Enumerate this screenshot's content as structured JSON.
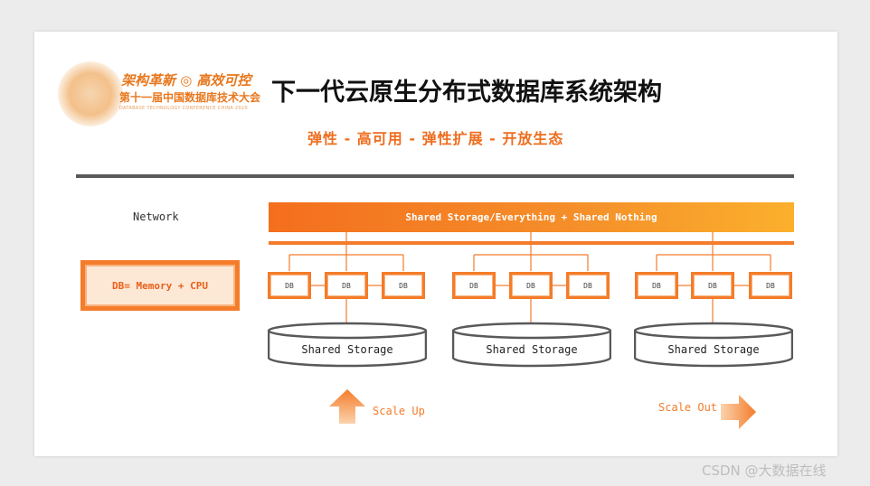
{
  "logo": {
    "line1": "架构革新 ◎ 高效可控",
    "line2": "第十一届中国数据库技术大会",
    "line3": "DATABASE TECHNOLOGY CONFERENCE CHINA 2020"
  },
  "title": "下一代云原生分布式数据库系统架构",
  "subtitle": "弹性 - 高可用 - 弹性扩展 - 开放生态",
  "network_label": "Network",
  "db_memory_label": "DB= Memory + CPU",
  "storage_bar_label": "Shared Storage/Everything + Shared Nothing",
  "db_label": "DB",
  "shared_storage_label": "Shared Storage",
  "scale_up_label": "Scale Up",
  "scale_out_label": "Scale Out",
  "watermark": "CSDN @大数据在线",
  "colors": {
    "accent": "#f47c2a",
    "rule": "#595959",
    "bar_end": "#fbb02c"
  }
}
